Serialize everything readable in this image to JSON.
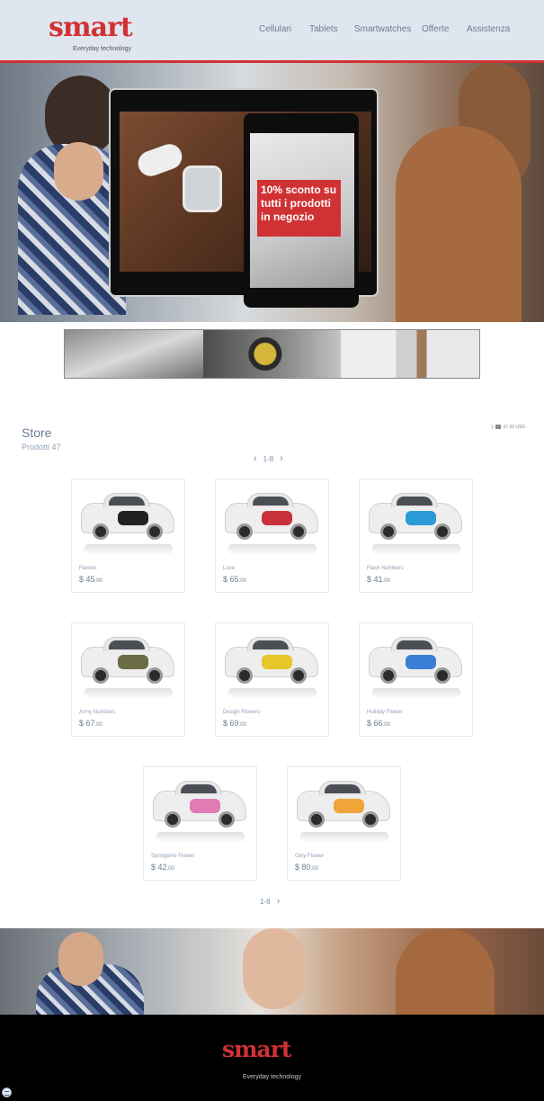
{
  "brand": {
    "logo_text": "smart",
    "tagline": "Everyday technology"
  },
  "nav": {
    "items": [
      "Cellulari",
      "Tablets",
      "Smartwatches",
      "Offerte",
      "Assistenza"
    ]
  },
  "hero": {
    "promo_text": "10% sconto su tutti i prodotti in negozio"
  },
  "store": {
    "title": "Store",
    "product_count": "Prodotti 47",
    "cart_summary_left": "1",
    "cart_summary_right": "67,00 USD",
    "pager_top": "1-8",
    "pager_bottom": "1-8",
    "products": [
      {
        "name": "Flames",
        "price_currency": "$ ",
        "price_main": "45",
        "price_cents": ".00",
        "decal_color": "#222222"
      },
      {
        "name": "Love",
        "price_currency": "$ ",
        "price_main": "65",
        "price_cents": ".00",
        "decal_color": "#c8323a"
      },
      {
        "name": "Flash Numbers",
        "price_currency": "$ ",
        "price_main": "41",
        "price_cents": ".00",
        "decal_color": "#2b9bd8"
      },
      {
        "name": "Army Numbers",
        "price_currency": "$ ",
        "price_main": "67",
        "price_cents": ".00",
        "decal_color": "#6b6b45"
      },
      {
        "name": "Design Flowers",
        "price_currency": "$ ",
        "price_main": "69",
        "price_cents": ".00",
        "decal_color": "#e6c62a"
      },
      {
        "name": "Holiday Flower",
        "price_currency": "$ ",
        "price_main": "66",
        "price_cents": ".00",
        "decal_color": "#3a7fd6"
      },
      {
        "name": "Springtime Flower",
        "price_currency": "$ ",
        "price_main": "42",
        "price_cents": ".00",
        "decal_color": "#e07bb4"
      },
      {
        "name": "Girly Flower",
        "price_currency": "$ ",
        "price_main": "80",
        "price_cents": ".00",
        "decal_color": "#f0a53b"
      }
    ]
  },
  "footer": {
    "logo_text": "smart",
    "tagline": "Everyday technology"
  },
  "colors": {
    "brand_red": "#d03234",
    "header_bg": "#dfe6ef",
    "footer_bg": "#000000"
  },
  "icons": [
    "chevron-left-icon",
    "chevron-right-icon",
    "cart-icon",
    "chat-icon"
  ]
}
